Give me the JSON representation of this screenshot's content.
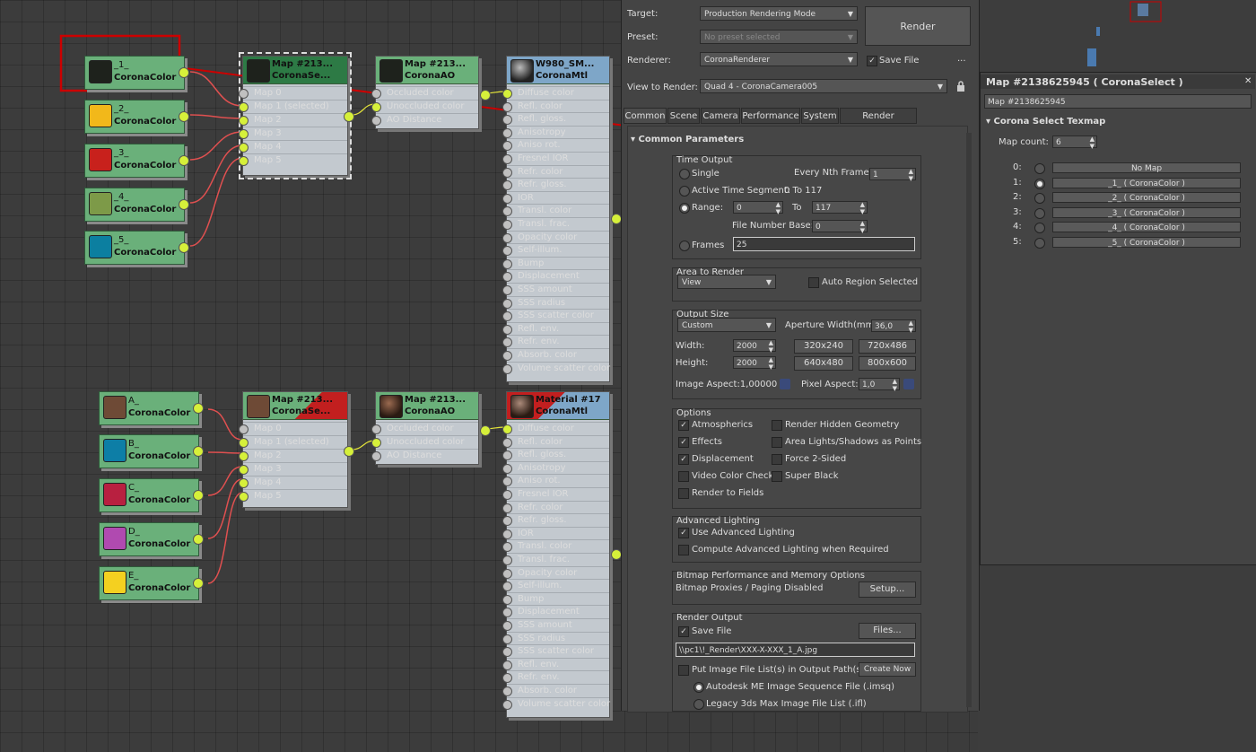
{
  "colors": {
    "node_green": "#6ab07a",
    "selection_red": "#cc0000",
    "wire_red": "#e05050",
    "socket_yellow": "#d6f03a"
  },
  "color_nodes_top": [
    {
      "name": "_1_",
      "type": "CoronaColor",
      "swatch": "#1e221c"
    },
    {
      "name": "_2_",
      "type": "CoronaColor",
      "swatch": "#f2b81a"
    },
    {
      "name": "_3_",
      "type": "CoronaColor",
      "swatch": "#c8211c"
    },
    {
      "name": "_4_",
      "type": "CoronaColor",
      "swatch": "#7d9a48"
    },
    {
      "name": "_5_",
      "type": "CoronaColor",
      "swatch": "#0c7fa0"
    }
  ],
  "color_nodes_bottom": [
    {
      "name": "A_",
      "type": "CoronaColor",
      "swatch": "#6e4a36"
    },
    {
      "name": "B_",
      "type": "CoronaColor",
      "swatch": "#0d7ea6"
    },
    {
      "name": "C_",
      "type": "CoronaColor",
      "swatch": "#b82040"
    },
    {
      "name": "D_",
      "type": "CoronaColor",
      "swatch": "#b04ab0"
    },
    {
      "name": "E_",
      "type": "CoronaColor",
      "swatch": "#f4d020"
    }
  ],
  "select_node": {
    "title": "Map #213...",
    "type_top": "CoronaSe...",
    "type_bottom": "CoronaSe...",
    "slots": [
      "Map 0",
      "Map 1 (selected)",
      "Map 2",
      "Map 3",
      "Map 4",
      "Map 5"
    ]
  },
  "ao_node": {
    "title": "Map #213...",
    "type": "CoronaAO",
    "slots": [
      "Occluded color",
      "Unoccluded color",
      "AO Distance"
    ]
  },
  "mtl_top": {
    "title": "W980_SM...",
    "type": "CoronaMtl"
  },
  "mtl_bottom": {
    "title": "Material #17",
    "type": "CoronaMtl"
  },
  "mtl_slots_top": [
    "Diffuse color",
    "Refl. color",
    "Refl. gloss.",
    "Anisotropy",
    "Aniso rot.",
    "Fresnel IOR",
    "Refr. color",
    "Refr. gloss.",
    "IOR",
    "Transl. color",
    "Transl. frac.",
    "Opacity color",
    "Self-illum.",
    "Bump",
    "Displacement",
    "SSS amount",
    "SSS radius",
    "SSS scatter color",
    "Refl. env.",
    "Refr. env.",
    "Absorb. color",
    "Volume scatter color"
  ],
  "mtl_slots_bottom": [
    "Diffuse color",
    "Refl. color",
    "Refl. gloss.",
    "Anisotropy",
    "Aniso rot.",
    "Fresnel IOR",
    "Refr. color",
    "Refr. gloss.",
    "IOR",
    "Transl. color",
    "Transl. frac.",
    "Opacity color",
    "Self-illum.",
    "Bump",
    "Displacement",
    "SSS amount",
    "SSS radius",
    "SSS scatter color",
    "Refl. env.",
    "Refr. env.",
    "Absorb. color",
    "Volume scatter color"
  ],
  "render": {
    "target_label": "Target:",
    "target_value": "Production Rendering Mode",
    "preset_label": "Preset:",
    "preset_value": "No preset selected",
    "renderer_label": "Renderer:",
    "renderer_value": "CoronaRenderer",
    "save_file": "Save File",
    "more": "...",
    "view_label": "View to Render:",
    "view_value": "Quad 4 - CoronaCamera005",
    "render_button": "Render",
    "tabs": [
      "Common",
      "Scene",
      "Camera",
      "Performance",
      "System",
      "Render Elements"
    ],
    "rollout": "Common Parameters",
    "time_output": {
      "title": "Time Output",
      "single": "Single",
      "every_nth": "Every Nth Frame:",
      "every_nth_val": "1",
      "active": "Active Time Segment:",
      "active_val": "0 To 117",
      "range": "Range:",
      "range_from": "0",
      "to": "To",
      "range_to": "117",
      "file_base": "File Number Base:",
      "file_base_val": "0",
      "frames": "Frames",
      "frames_val": "25"
    },
    "area": {
      "title": "Area to Render",
      "value": "View",
      "auto_region": "Auto Region Selected"
    },
    "output_size": {
      "title": "Output Size",
      "preset": "Custom",
      "aperture": "Aperture Width(mm):",
      "aperture_val": "36,0",
      "width": "Width:",
      "width_val": "2000",
      "height": "Height:",
      "height_val": "2000",
      "p1": "320x240",
      "p2": "720x486",
      "p3": "640x480",
      "p4": "800x600",
      "aspect": "Image Aspect:1,00000",
      "pixel_aspect": "Pixel Aspect:",
      "pixel_aspect_val": "1,0"
    },
    "options": {
      "title": "Options",
      "atmo": "Atmospherics",
      "hidden": "Render Hidden Geometry",
      "effects": "Effects",
      "area_lights": "Area Lights/Shadows as Points",
      "displacement": "Displacement",
      "force2": "Force 2-Sided",
      "video": "Video Color Check",
      "super_black": "Super Black",
      "fields": "Render to Fields"
    },
    "adv": {
      "title": "Advanced Lighting",
      "use": "Use Advanced Lighting",
      "compute": "Compute Advanced Lighting when Required"
    },
    "bitmap": {
      "title": "Bitmap Performance and Memory Options",
      "proxies": "Bitmap Proxies / Paging Disabled",
      "setup": "Setup..."
    },
    "output": {
      "title": "Render Output",
      "save": "Save File",
      "files": "Files...",
      "path": "\\\\pc1\\!_Render\\XXX-X-XXX_1_A.jpg",
      "put_list": "Put Image File List(s) in Output Path(s)",
      "create_now": "Create Now",
      "imsq": "Autodesk ME Image Sequence File (.imsq)",
      "ifl": "Legacy 3ds Max Image File List (.ifl)"
    }
  },
  "select_panel": {
    "title": "Map #2138625945  ( CoronaSelect )",
    "name_field": "Map #2138625945",
    "rollout": "Corona Select Texmap",
    "map_count_label": "Map count:",
    "map_count": "6",
    "slots": [
      {
        "idx": "0:",
        "label": "No Map"
      },
      {
        "idx": "1:",
        "label": "_1_  ( CoronaColor )"
      },
      {
        "idx": "2:",
        "label": "_2_  ( CoronaColor )"
      },
      {
        "idx": "3:",
        "label": "_3_  ( CoronaColor )"
      },
      {
        "idx": "4:",
        "label": "_4_  ( CoronaColor )"
      },
      {
        "idx": "5:",
        "label": "_5_  ( CoronaColor )"
      }
    ]
  }
}
